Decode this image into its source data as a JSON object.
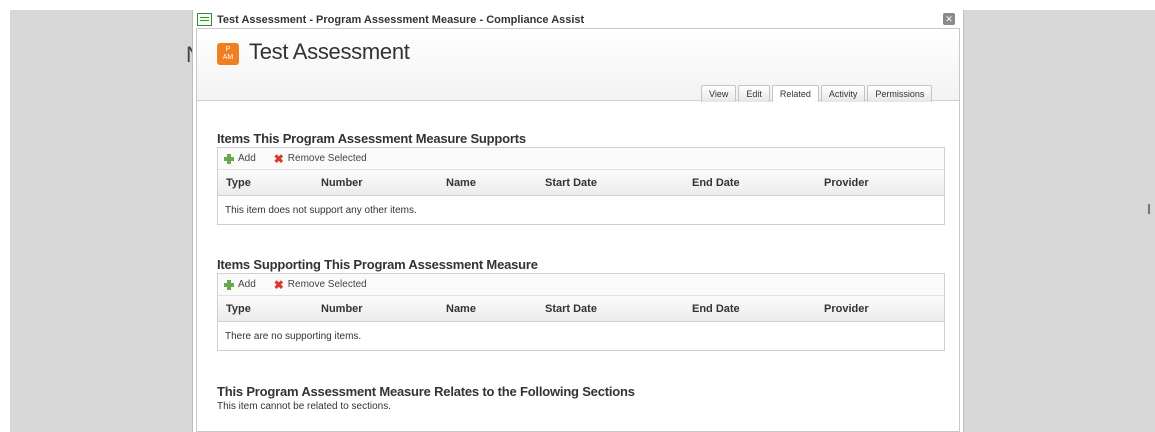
{
  "window": {
    "title": "Test Assessment - Program Assessment Measure - Compliance Assist",
    "close_glyph": "✕"
  },
  "background": {
    "edge_char": "N"
  },
  "record": {
    "badge_line1": "P",
    "badge_line2": "AM",
    "title": "Test Assessment"
  },
  "tabs": [
    {
      "label": "View"
    },
    {
      "label": "Edit"
    },
    {
      "label": "Related",
      "active": true
    },
    {
      "label": "Activity"
    },
    {
      "label": "Permissions"
    }
  ],
  "columns": [
    "Type",
    "Number",
    "Name",
    "Start Date",
    "End Date",
    "Provider"
  ],
  "toolbar": {
    "add_label": "Add",
    "remove_label": "Remove Selected"
  },
  "supports": {
    "heading": "Items This Program Assessment Measure Supports",
    "empty_text": "This item does not support any other items."
  },
  "supporting": {
    "heading": "Items Supporting This Program Assessment Measure",
    "empty_text": "There are no supporting items."
  },
  "sections": {
    "heading": "This Program Assessment Measure Relates to the Following Sections",
    "note": "This item cannot be related to sections."
  },
  "colors": {
    "badge": "#f07f1f",
    "add_icon": "#6aa84f",
    "remove_icon": "#d8382a"
  }
}
